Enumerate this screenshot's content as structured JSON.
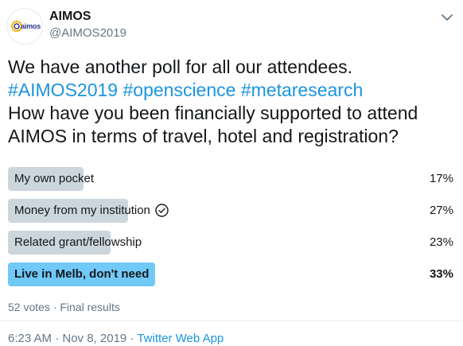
{
  "header": {
    "avatar_text": "aimos",
    "name": "AIMOS",
    "handle": "@AIMOS2019"
  },
  "tweet": {
    "line1": "We have another poll for all our attendees.",
    "hashtags": [
      "#AIMOS2019",
      "#openscience",
      "#metaresearch"
    ],
    "line3": "How have you been financially supported to attend",
    "line4": "AIMOS in terms of travel, hotel and registration?"
  },
  "poll": {
    "options": [
      {
        "label": "My own pocket",
        "percent_text": "17%",
        "percent": 17,
        "winner": false,
        "selected": false
      },
      {
        "label": "Money from my institution",
        "percent_text": "27%",
        "percent": 27,
        "winner": false,
        "selected": true
      },
      {
        "label": "Related grant/fellowship",
        "percent_text": "23%",
        "percent": 23,
        "winner": false,
        "selected": false
      },
      {
        "label": "Live in Melb, don't need",
        "percent_text": "33%",
        "percent": 33,
        "winner": true,
        "selected": false
      }
    ],
    "meta": "52 votes · Final results"
  },
  "footer": {
    "time": "6:23 AM · Nov 8, 2019 · ",
    "source": "Twitter Web App"
  },
  "colors": {
    "bar": "#ccd6dd",
    "winner_bar": "#71c9f8",
    "link": "#1b95e0",
    "muted": "#657786"
  },
  "icons": {
    "caret": "chevron-down-icon",
    "check": "check-circle-icon"
  }
}
